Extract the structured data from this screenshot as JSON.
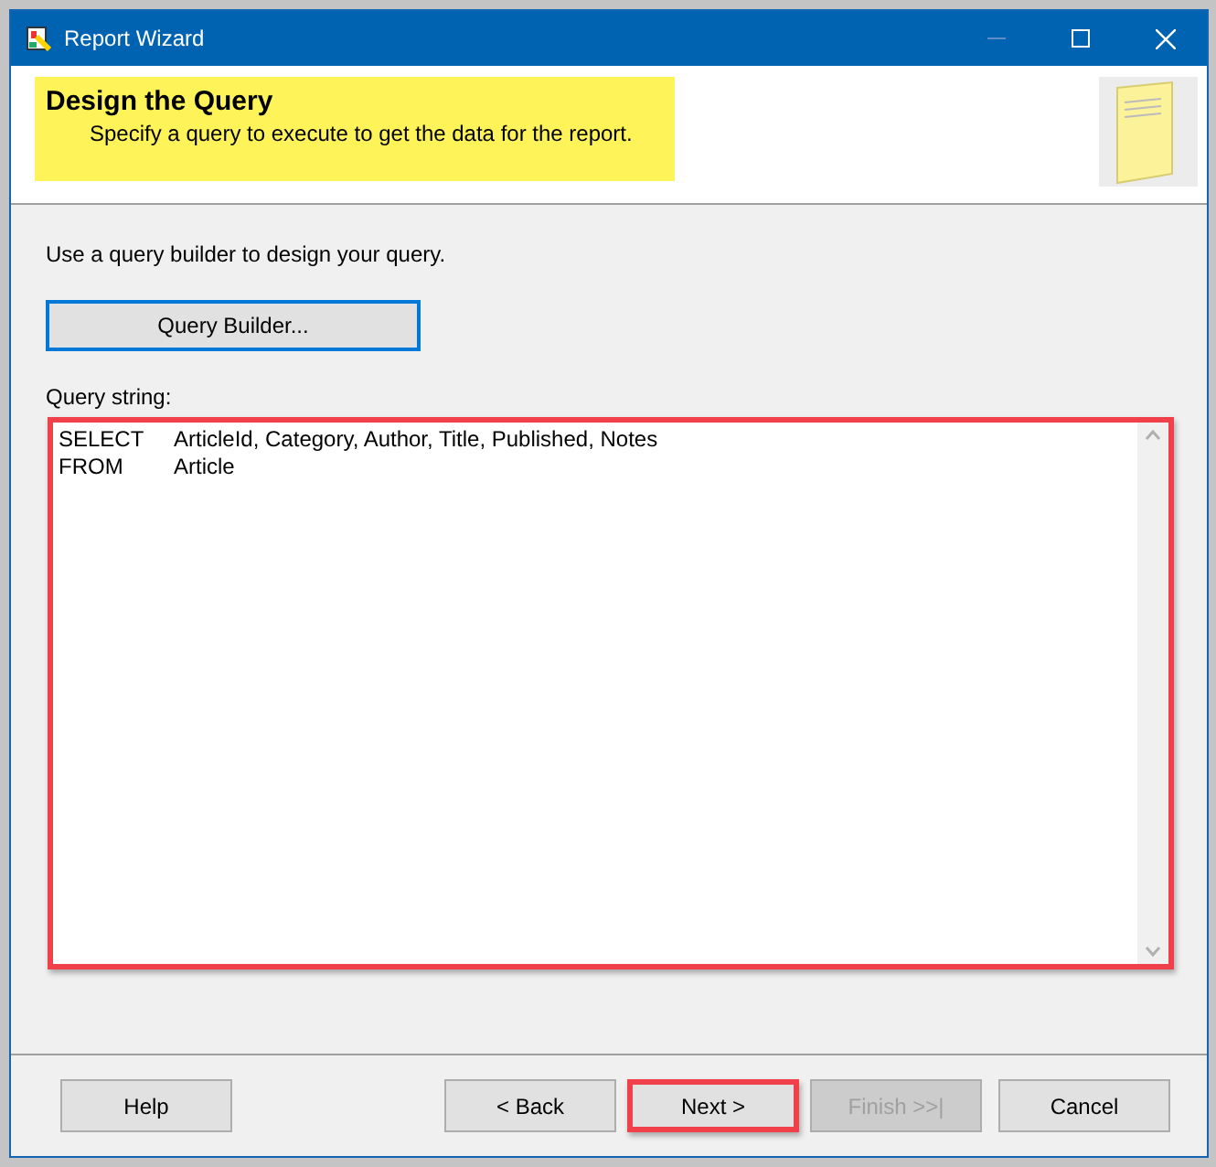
{
  "window": {
    "title": "Report Wizard"
  },
  "header": {
    "title": "Design the Query",
    "subtitle": "Specify a query to execute to get the data for the report."
  },
  "instruction": "Use a query builder to design your query.",
  "query_builder_button": {
    "label": "Query Builder...",
    "focused": true
  },
  "query": {
    "label": "Query string:",
    "highlighted": true,
    "lines": [
      {
        "keyword": "SELECT",
        "text": "ArticleId, Category, Author, Title, Published, Notes"
      },
      {
        "keyword": "FROM",
        "text": "Article"
      }
    ]
  },
  "buttons": [
    {
      "label": "Help",
      "disabled": false,
      "highlighted": false
    },
    {
      "label": "< Back",
      "disabled": false,
      "highlighted": false
    },
    {
      "label": "Next >",
      "disabled": false,
      "highlighted": true
    },
    {
      "label": "Finish >>|",
      "disabled": true,
      "highlighted": false
    },
    {
      "label": "Cancel",
      "disabled": false,
      "highlighted": false
    }
  ]
}
